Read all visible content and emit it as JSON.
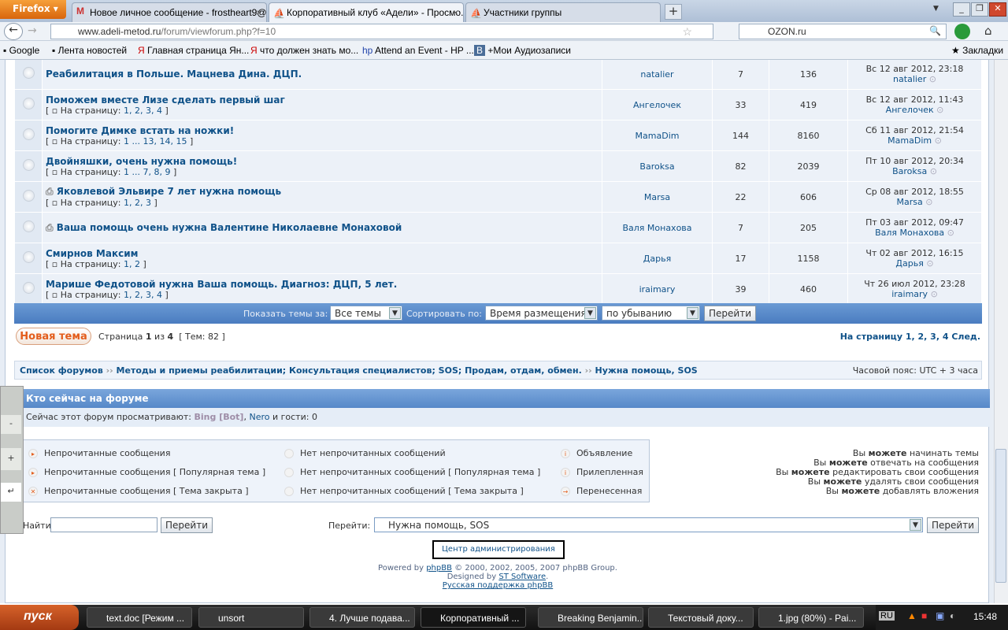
{
  "browser": {
    "menu_button": "Firefox",
    "tabs": [
      {
        "title": "Новое личное сообщение - frostheart9@...",
        "icon": "gmail-icon",
        "active": false
      },
      {
        "title": "Корпоративный клуб «Адели» - Просмо...",
        "icon": "site-icon",
        "active": true
      },
      {
        "title": "Участники группы",
        "icon": "site-icon",
        "active": false
      }
    ],
    "url_domain": "www.adeli-metod.ru",
    "url_path": "/forum/viewforum.php?f=10",
    "search_value": "OZON.ru",
    "bookmarks": [
      "Google",
      "Лента новостей",
      "Главная страница Ян...",
      "что должен знать мо...",
      "Attend an Event - HP ...",
      "+Мои Аудиозаписи"
    ],
    "bookmarks_menu": "Закладки"
  },
  "topics": [
    {
      "title": "Реабилитация в Польше. Мацнева Дина. ДЦП.",
      "pages": null,
      "author": "natalier",
      "replies": "7",
      "views": "136",
      "last_date": "Вс 12 авг 2012, 23:18",
      "last_user": "natalier",
      "attach": false
    },
    {
      "title": "Поможем вместе Лизе сделать первый шаг",
      "pages": "1, 2, 3, 4",
      "author": "Ангелочек",
      "replies": "33",
      "views": "419",
      "last_date": "Вс 12 авг 2012, 11:43",
      "last_user": "Ангелочек",
      "attach": false
    },
    {
      "title": "Помогите Димке встать на ножки!",
      "pages": "1 ... 13, 14, 15",
      "author": "MamaDim",
      "replies": "144",
      "views": "8160",
      "last_date": "Сб 11 авг 2012, 21:54",
      "last_user": "MamaDim",
      "attach": false
    },
    {
      "title": "Двойняшки, очень нужна помощь!",
      "pages": "1 ... 7, 8, 9",
      "author": "Baroksa",
      "replies": "82",
      "views": "2039",
      "last_date": "Пт 10 авг 2012, 20:34",
      "last_user": "Baroksa",
      "attach": false
    },
    {
      "title": "Яковлевой Эльвире 7 лет нужна помощь",
      "pages": "1, 2, 3",
      "author": "Marsa",
      "replies": "22",
      "views": "606",
      "last_date": "Ср 08 авг 2012, 18:55",
      "last_user": "Marsa",
      "attach": true
    },
    {
      "title": "Ваша помощь очень нужна Валентине Николаевне Монаховой",
      "pages": null,
      "author": "Валя Монахова",
      "replies": "7",
      "views": "205",
      "last_date": "Пт 03 авг 2012, 09:47",
      "last_user": "Валя Монахова",
      "attach": true
    },
    {
      "title": "Смирнов Максим",
      "pages": "1, 2",
      "author": "Дарья",
      "replies": "17",
      "views": "1158",
      "last_date": "Чт 02 авг 2012, 16:15",
      "last_user": "Дарья",
      "attach": false
    },
    {
      "title": "Марише Федотовой нужна Ваша помощь. Диагноз: ДЦП, 5 лет.",
      "pages": "1, 2, 3, 4",
      "author": "iraimary",
      "replies": "39",
      "views": "460",
      "last_date": "Чт 26 июл 2012, 23:28",
      "last_user": "iraimary",
      "attach": false
    }
  ],
  "pages_prefix": "На страницу:",
  "sortbar": {
    "show_label": "Показать темы за:",
    "show_value": "Все темы",
    "sort_label": "Сортировать по:",
    "sort_value": "Время размещения",
    "order_value": "по убыванию",
    "go": "Перейти"
  },
  "pagination": {
    "new_topic": "Новая тема",
    "page_text": "Страница",
    "current": "1",
    "of": "из",
    "total": "4",
    "topics": "[ Тем: 82 ]",
    "goto": "На страницу",
    "pages": "1, 2, 3, 4",
    "next": "След."
  },
  "breadcrumbs": [
    "Список форумов",
    "Методы и приемы реабилитации; Консультация специалистов; SOS; Продам, отдам, обмен.",
    "Нужна помощь, SOS"
  ],
  "timezone": "Часовой пояс: UTC + 3 часа",
  "who": {
    "title": "Кто сейчас на форуме",
    "text": "Сейчас этот форум просматривают:",
    "bot": "Bing [Bot]",
    "user": "Nero",
    "guests": "и гости: 0"
  },
  "legend": [
    [
      "Непрочитанные сообщения",
      "Нет непрочитанных сообщений",
      "Объявление"
    ],
    [
      "Непрочитанные сообщения [ Популярная тема ]",
      "Нет непрочитанных сообщений [ Популярная тема ]",
      "Прилепленная"
    ],
    [
      "Непрочитанные сообщения [ Тема закрыта ]",
      "Нет непрочитанных сообщений [ Тема закрыта ]",
      "Перенесенная"
    ]
  ],
  "permissions": [
    [
      "Вы",
      "можете",
      "начинать темы"
    ],
    [
      "Вы",
      "можете",
      "отвечать на сообщения"
    ],
    [
      "Вы",
      "можете",
      "редактировать свои сообщения"
    ],
    [
      "Вы",
      "можете",
      "удалять свои сообщения"
    ],
    [
      "Вы",
      "можете",
      "добавлять вложения"
    ]
  ],
  "search": {
    "label": "Найти:",
    "value": "",
    "go": "Перейти"
  },
  "jump": {
    "label": "Перейти:",
    "value": "Нужна помощь, SOS",
    "go": "Перейти"
  },
  "admin_link": "Центр администрирования",
  "footer": {
    "powered": "Powered by",
    "phpbb": "phpBB",
    "copy": "© 2000, 2002, 2005, 2007 phpBB Group.",
    "designed": "Designed by",
    "st": "ST Software",
    "dot": ".",
    "ru": "Русская поддержка phpBB"
  },
  "zoom_widget": {
    "minus": "-",
    "plus": "+",
    "enter": "↵"
  },
  "taskbar": {
    "start": "пуск",
    "items": [
      "text.doc [Режим ...",
      "unsort",
      "4. Лучше подава...",
      "Корпоративный ...",
      "Breaking Benjamin...",
      "Текстовый доку...",
      "1.jpg (80%) - Pai..."
    ],
    "active_index": 3,
    "lang": "RU",
    "clock": "15:48"
  }
}
